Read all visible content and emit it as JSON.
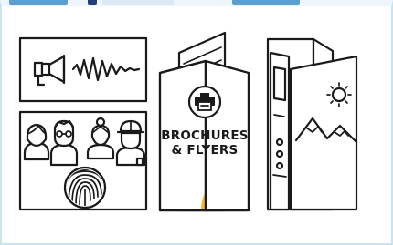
{
  "illustration": {
    "brochure_title_line1": "BROCHURES",
    "brochure_title_line2": "& FLYERS",
    "accent_color": "#f5b731",
    "line_color": "#1a1a1a",
    "panels": [
      {
        "name": "megaphone-panel",
        "icons": [
          "megaphone-icon",
          "sound-wave-icon"
        ]
      },
      {
        "name": "team-panel",
        "icons": [
          "team-icon",
          "fingerprint-icon"
        ]
      },
      {
        "name": "brochure-panel",
        "icons": [
          "printer-icon"
        ]
      },
      {
        "name": "flyer-panel",
        "icons": [
          "sun-icon",
          "mountains-icon"
        ]
      }
    ]
  }
}
